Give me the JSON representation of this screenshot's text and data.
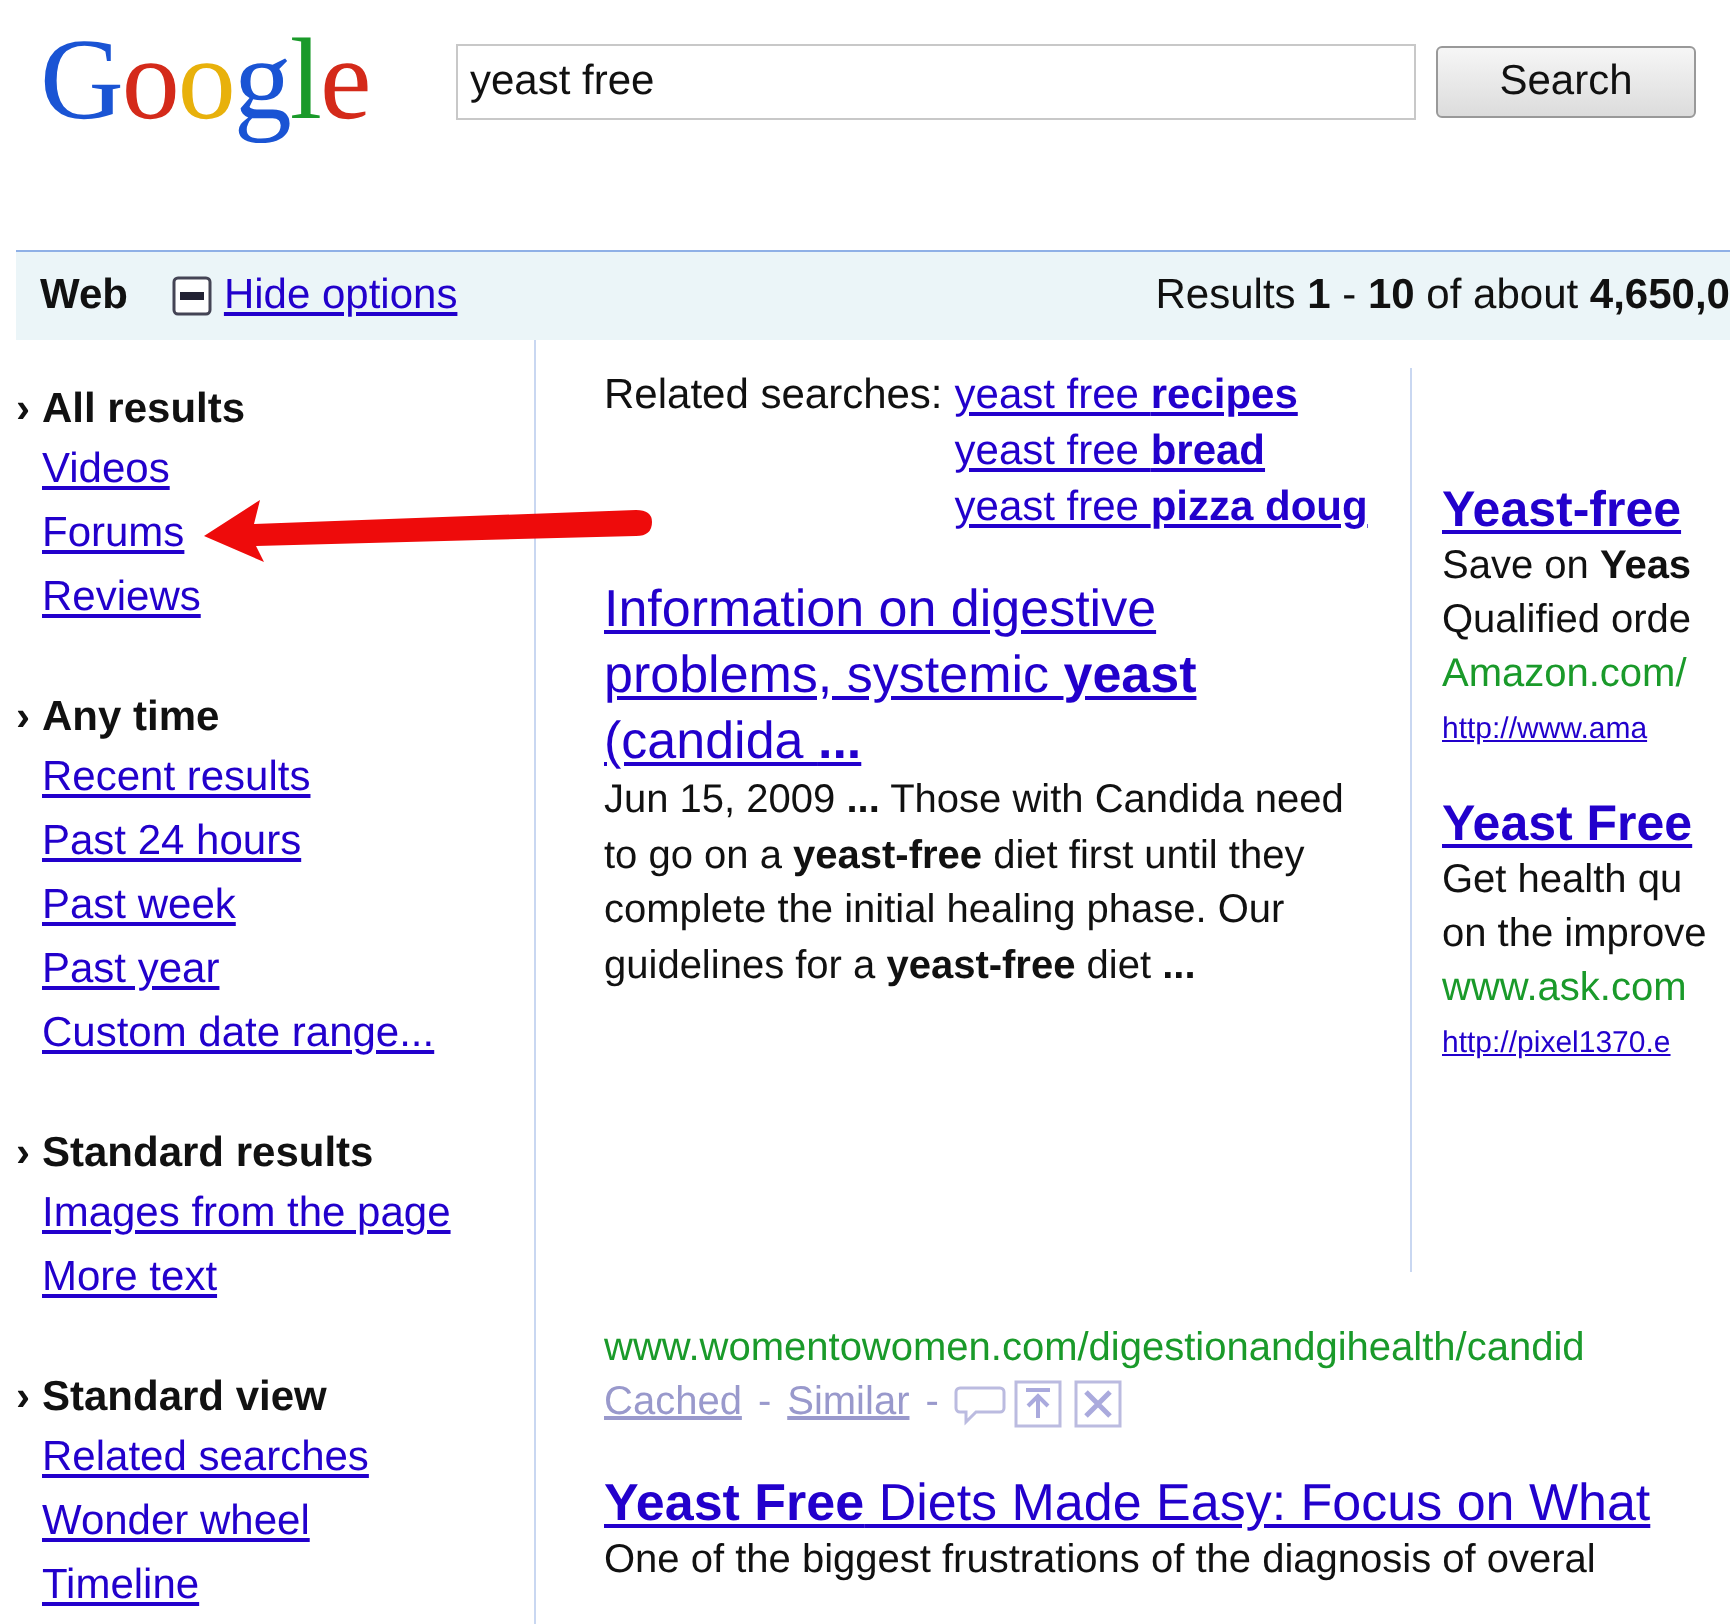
{
  "logo": {
    "text": "Google"
  },
  "search": {
    "value": "yeast free",
    "button": "Search"
  },
  "options_bar": {
    "section": "Web",
    "toggle": "Hide options",
    "results": "Results **1** - **10** of about **4,650,0**"
  },
  "sidebar": [
    {
      "marker": "›",
      "heading": "All results",
      "items": [
        "Videos",
        "Forums",
        "Reviews"
      ]
    },
    {
      "marker": "›",
      "heading": "Any time",
      "items": [
        "Recent results",
        "Past 24 hours",
        "Past week",
        "Past year",
        "Custom date range..."
      ]
    },
    {
      "marker": "›",
      "heading": "Standard results",
      "items": [
        "Images from the page",
        "More text"
      ]
    },
    {
      "marker": "›",
      "heading": "Standard view",
      "items": [
        "Related searches",
        "Wonder wheel",
        "Timeline"
      ]
    }
  ],
  "related": {
    "label": "Related searches:",
    "links": [
      "yeast free **recipes**",
      "yeast free **bread**",
      "yeast free **pizza doug**"
    ]
  },
  "results": [
    {
      "title": "Information on digestive problems, systemic **yeast** (candida **...**",
      "snippet": "Jun 15, 2009 **...** Those with Candida need to go on a **yeast-free** diet first until they complete the initial healing phase. Our guidelines for a **yeast-free** diet **...**",
      "url": "www.womentowomen.com/digestionandgihealth/candid",
      "cached": "Cached",
      "similar": "Similar",
      "separator": "-"
    },
    {
      "title": "**Yeast Free** Diets Made Easy: Focus on What",
      "snippet": "One of the biggest frustrations of the diagnosis of overal"
    }
  ],
  "ads": [
    {
      "title": "Yeast-free",
      "lines": [
        "Save on **Yeas**",
        "Qualified orde"
      ],
      "display_url": "Amazon.com/",
      "link": "http://www.ama"
    },
    {
      "title": "Yeast Free",
      "lines": [
        "Get health qu",
        "on the improve"
      ],
      "display_url": "www.ask.com",
      "link": "http://pixel1370.e"
    }
  ]
}
